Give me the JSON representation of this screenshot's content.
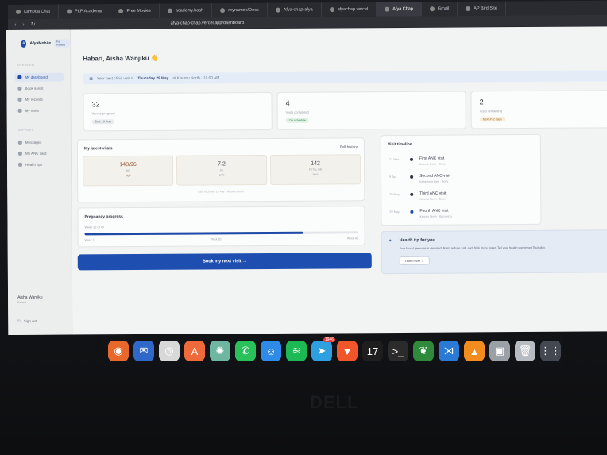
{
  "browser": {
    "tabs": [
      {
        "label": "Lambda Chat",
        "active": false
      },
      {
        "label": "PLP Academy",
        "active": false
      },
      {
        "label": "Free Movies",
        "active": false
      },
      {
        "label": "academy.hash",
        "active": false
      },
      {
        "label": "reynamee/Docs",
        "active": false
      },
      {
        "label": "Afya-chap-afya",
        "active": false
      },
      {
        "label": "afyachap.vercel",
        "active": false
      },
      {
        "label": "Afya Chap",
        "active": true
      },
      {
        "label": "Gmail",
        "active": false
      },
      {
        "label": "AP Bird Site",
        "active": false
      }
    ],
    "address": "afya-chap-chap.vercel.app/dashboard"
  },
  "sidebar": {
    "logo_mark": "A",
    "brand": "AfyaMobile",
    "role": "For Patient",
    "section_main": "OVERVIEW",
    "section_other": "SUPPORT",
    "items": [
      {
        "label": "My dashboard",
        "active": true
      },
      {
        "label": "Book a visit",
        "active": false
      },
      {
        "label": "My records",
        "active": false
      },
      {
        "label": "My visits",
        "active": false
      },
      {
        "label": "Messages",
        "active": false
      },
      {
        "label": "My ANC card",
        "active": false
      },
      {
        "label": "Health tips",
        "active": false
      }
    ],
    "user_name": "Aisha Wanjiku",
    "user_sub": "Patient",
    "signout": "Sign out"
  },
  "main": {
    "greeting": "Habari, Aisha Wanjiku",
    "greeting_emoji": "👋",
    "banner_prefix": "Your next clinic visit is",
    "banner_date": "Thursday 29 May",
    "banner_suffix": "at Kisumu North · 10:00 AM",
    "stats": [
      {
        "value": "32",
        "label": "Weeks pregnant",
        "pill": "Due 19 Aug",
        "pill_bg": "#e9ecef",
        "pill_fg": "#6b7280"
      },
      {
        "value": "4",
        "label": "Visits completed",
        "pill": "On schedule",
        "pill_bg": "#e1f1e4",
        "pill_fg": "#3c8a50"
      },
      {
        "value": "2",
        "label": "Visits remaining",
        "pill": "Next in 2 days",
        "pill_bg": "#f6ecd7",
        "pill_fg": "#a7742a"
      }
    ],
    "vitals": {
      "title": "My latest vitals",
      "link": "Full history",
      "items": [
        {
          "value": "148/96",
          "label": "BP",
          "tag": "high",
          "alert": true
        },
        {
          "value": "7.2",
          "label": "Hb",
          "tag": "g/dL",
          "alert": false
        },
        {
          "value": "142",
          "label": "FETAL HR",
          "tag": "bpm",
          "alert": false
        }
      ],
      "footer": "Last recorded 23 Mar · Kisumu North"
    },
    "progress": {
      "title": "Pregnancy progress",
      "subtitle": "Week 32 of 40",
      "percent": 0.8,
      "start": "Week 1",
      "mid": "Week 20",
      "end": "Week 40"
    },
    "cta": "Book my next visit →",
    "timeline": {
      "title": "Visit timeline",
      "items": [
        {
          "date": "12 Mar",
          "name": "First ANC visit",
          "sub": "Kisumu North · Done"
        },
        {
          "date": "9 Apr",
          "name": "Second ANC visit",
          "sub": "Kakamega East · Done"
        },
        {
          "date": "30 May",
          "name": "Third ANC visit",
          "sub": "Kisumu North · Done"
        },
        {
          "date": "29 May",
          "name": "Fourth ANC visit",
          "sub": "Kisumu North · Upcoming"
        }
      ]
    },
    "tip": {
      "icon": "✦",
      "title": "Health tip for you",
      "body": "Your blood pressure is elevated. Rest, reduce salt, and drink more water. Tell your health worker on Thursday.",
      "button": "Learn more ↗"
    }
  },
  "dock": {
    "items": [
      {
        "name": "firefox",
        "color": "#e8672a",
        "glyph": "◉"
      },
      {
        "name": "thunderbird",
        "color": "#2f68c9",
        "glyph": "✉"
      },
      {
        "name": "photo-booth",
        "color": "#d8d8d8",
        "glyph": "◎"
      },
      {
        "name": "app-store",
        "color": "#ef6a3a",
        "glyph": "A"
      },
      {
        "name": "chatgpt",
        "color": "#6fb6a0",
        "glyph": "✺"
      },
      {
        "name": "whatsapp",
        "color": "#29c25a",
        "glyph": "✆"
      },
      {
        "name": "finder",
        "color": "#2f8be8",
        "glyph": "☺"
      },
      {
        "name": "spotify",
        "color": "#1db954",
        "glyph": "≋"
      },
      {
        "name": "telegram",
        "color": "#2fa0df",
        "glyph": "➤",
        "badge": "1946"
      },
      {
        "name": "brave",
        "color": "#f0562a",
        "glyph": "▼"
      },
      {
        "name": "tradingview",
        "color": "#1e1e1e",
        "glyph": "17"
      },
      {
        "name": "terminal",
        "color": "#2b2b2b",
        "glyph": ">_"
      },
      {
        "name": "mongodb",
        "color": "#2f8a3c",
        "glyph": "❦"
      },
      {
        "name": "vscode",
        "color": "#2a7ad6",
        "glyph": "⋊"
      },
      {
        "name": "vlc",
        "color": "#f28c1e",
        "glyph": "▲"
      },
      {
        "name": "disk-utility",
        "color": "#9aa0a6",
        "glyph": "▣"
      },
      {
        "name": "trash",
        "color": "#b7bcc2",
        "glyph": "🗑"
      },
      {
        "name": "launchpad",
        "color": "#444851",
        "glyph": "⋮⋮"
      }
    ]
  },
  "bezel_brand": "DELL"
}
